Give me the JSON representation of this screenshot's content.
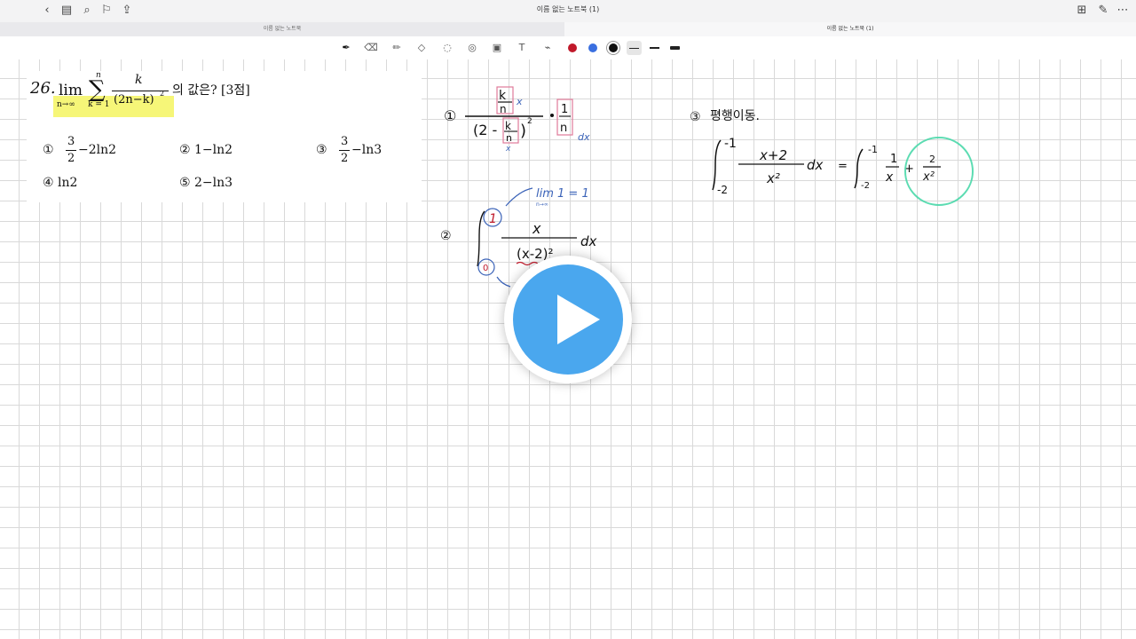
{
  "window": {
    "title": "이름 없는 노트북 (1)"
  },
  "tabs": [
    {
      "label": "이름 없는 노트북",
      "active": false
    },
    {
      "label": "이름 없는 노트북 (1)",
      "active": true
    }
  ],
  "toolbar": {
    "tools": [
      "pen-icon",
      "eraser-icon",
      "highlighter-icon",
      "shapes-icon",
      "lasso-icon",
      "element-icon",
      "image-icon",
      "text-icon",
      "laser-pointer-icon"
    ],
    "colors": [
      "#c0192a",
      "#3a6fe0",
      "#111111"
    ],
    "stroke_widths": [
      "thin",
      "medium",
      "thick"
    ]
  },
  "problem": {
    "number": "26.",
    "lim": "lim",
    "lim_sub": "n→∞",
    "sum_top": "n",
    "sum_bottom": "k = 1",
    "frac_num": "k",
    "frac_den": "(2n−k)",
    "exp": "2",
    "question": "의 값은? [3점]",
    "choices": [
      {
        "mark": "①",
        "whole": "",
        "num": "3",
        "den": "2",
        "rest": "−2ln2"
      },
      {
        "mark": "②",
        "whole": "1−ln2"
      },
      {
        "mark": "③",
        "whole": "",
        "num": "3",
        "den": "2",
        "rest": "−ln3"
      },
      {
        "mark": "④",
        "whole": "ln2"
      },
      {
        "mark": "⑤",
        "whole": "2−ln3"
      }
    ]
  },
  "handwriting": {
    "step1_mark": "①",
    "step1_num": "k",
    "step1_den": "n",
    "step1_var": "x",
    "step1_den_expr": "(2 -",
    "step1_sq": "2",
    "step1_one": "1",
    "step1_dx": "dx",
    "step2_mark": "②",
    "lim_note": "lim 1 = 1",
    "lim_note_sub": "n→∞",
    "upper": "1",
    "lower": "0",
    "integrand_num": "x",
    "integrand_den": "(x-2)²",
    "dx": "dx",
    "step3_mark": "③",
    "step3_label": "평행이동.",
    "int_top": "-1",
    "int_bottom": "-2",
    "int_num": "x+2",
    "int_den": "x²",
    "equals": "=",
    "rhs_top": "-1",
    "rhs_bottom": "-2",
    "rhs_term1_num": "1",
    "rhs_term1_den": "x",
    "plus": "+",
    "rhs_term2_num": "2",
    "rhs_term2_den": "x²"
  },
  "colors": {
    "blue_ink": "#3b63b8",
    "pink_box": "#e07a9a",
    "red_ink": "#c0192a",
    "highlight": "#f5f560",
    "play_button": "#4aa7ee",
    "cursor_ring": "#3fd6a4"
  }
}
